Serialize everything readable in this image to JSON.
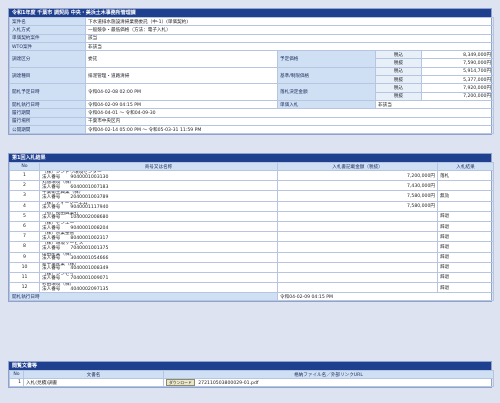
{
  "title": "令和1年度 千葉市 調契局 中央・美浜土木事務所管理課",
  "info": {
    "rows": [
      {
        "label": "案件名",
        "value": "下水道排水施設清掃業務委託（中-1）(単価契約)"
      },
      {
        "label": "入札方式",
        "value": "一般競争・最低価格（方法：電子入札）"
      },
      {
        "label": "単価契約案件",
        "value": "該当"
      },
      {
        "label": "WTO案件",
        "value": "非該当"
      }
    ],
    "contract_kind_label": "調達区分",
    "contract_kind": "委託",
    "planned_price_label": "予定価格",
    "industry_label": "調達種目",
    "industry": "排泥管理・道路清掃",
    "base_price_label": "基準/制限価格",
    "open_label": "開札予定日時",
    "open_value": "令和04-02-08 02:00 PM",
    "winning_price_label": "落札決定金額",
    "price_tax_in": "税込",
    "price_tax_out": "税抜",
    "planned_in": "8,349,000円",
    "planned_out": "7,590,000円",
    "base_in": "5,914,700円",
    "base_out": "5,377,000円",
    "win_in": "7,920,000円",
    "win_out": "7,200,000円",
    "bid_date_label": "開札執行日時",
    "bid_date": "令和04-02-09 04:15 PM",
    "single_label": "単価入札",
    "single_value": "非該当",
    "period_label": "履行期間",
    "period": "令和04-04-01 ～ 令和04-09-30",
    "place_label": "履行場所",
    "place": "千葉市中央区内",
    "public_label": "公開期間",
    "public": "令和04-02-14 05:00 PM ～ 令和05-03-31 11:59 PM"
  },
  "results": {
    "header": "第1回入札結果",
    "col_no": "No",
    "col_name": "商号又は名称",
    "col_amount": "入札書記載金額（税抜）",
    "col_result": "入札結果",
    "corp_label": "法人番号",
    "rows": [
      {
        "no": "1",
        "name": "（株）シンドウ環境センター",
        "corp": "9040001003130",
        "amount": "7,200,000円",
        "result": "落札"
      },
      {
        "no": "2",
        "name": "丸徳環境（株）",
        "corp": "6040001007183",
        "amount": "7,430,000円",
        "result": ""
      },
      {
        "no": "3",
        "name": "千葉衛生興業（株）",
        "corp": "2040001003789",
        "amount": "7,580,000円",
        "result": "無効"
      },
      {
        "no": "4",
        "name": "（株）ティーシーエム",
        "corp": "9040001117940",
        "amount": "7,580,000円",
        "result": ""
      },
      {
        "no": "5",
        "name": "（有）長田興業社",
        "corp": "1040002008680",
        "amount": "",
        "result": "辞退"
      },
      {
        "no": "6",
        "name": "（株）センエー",
        "corp": "9040001008204",
        "amount": "",
        "result": "辞退"
      },
      {
        "no": "7",
        "name": "（株）京業整管",
        "corp": "8040001002317",
        "amount": "",
        "result": "辞退"
      },
      {
        "no": "8",
        "name": "（株）環境サービス",
        "corp": "7040001001375",
        "amount": "",
        "result": "辞退"
      },
      {
        "no": "9",
        "name": "山田産業（株）",
        "corp": "3040001054666",
        "amount": "",
        "result": "辞退"
      },
      {
        "no": "10",
        "name": "新千葉産業（株）",
        "corp": "4040001008349",
        "amount": "",
        "result": "辞退"
      },
      {
        "no": "11",
        "name": "（株）シンセイ",
        "corp": "7040001009071",
        "amount": "",
        "result": "辞退"
      },
      {
        "no": "12",
        "name": "杉田環境（株）",
        "corp": "4040002097135",
        "amount": "",
        "result": "辞退"
      }
    ],
    "footer_label": "開札執行日時",
    "footer_value": "令和04-02-09 04:15 PM"
  },
  "docs": {
    "header": "閲覧文書等",
    "col_no": "No",
    "col_name": "文書名",
    "col_file": "格納ファイル名／外部リンクURL",
    "rows": [
      {
        "no": "1",
        "name": "入札(見積)調書",
        "button": "ダウンロード",
        "file": "272110503800029-01.pdf"
      }
    ]
  }
}
